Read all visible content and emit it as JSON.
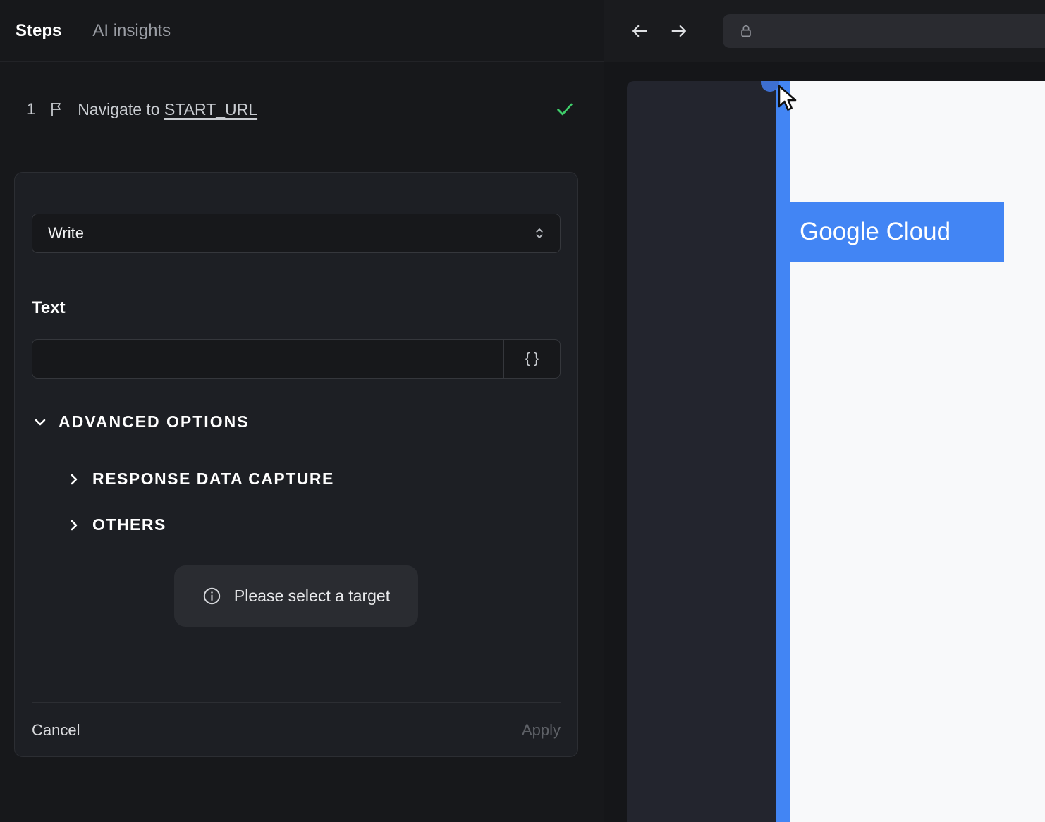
{
  "left_panel": {
    "tabs": [
      {
        "label": "Steps"
      },
      {
        "label": "AI insights"
      }
    ],
    "step": {
      "index": "1",
      "text": "Navigate to",
      "link": "START_URL"
    },
    "editor": {
      "action": {
        "value": "Write"
      },
      "text_field": {
        "label": "Text",
        "value": "",
        "placeholder": ""
      },
      "braces_button": "{ }",
      "advanced_toggle": "ADVANCED OPTIONS",
      "sections": [
        {
          "label": "RESPONSE DATA CAPTURE"
        },
        {
          "label": "OTHERS"
        }
      ],
      "notice": "Please select a target",
      "footer": {
        "cancel": "Cancel",
        "apply": "Apply"
      }
    }
  },
  "browser": {
    "address_bar": {
      "value": ""
    },
    "page": {
      "selected_element": "Google Cloud"
    }
  },
  "colors": {
    "accent_blue": "#4285f4",
    "success_green": "#3fcf6b",
    "panel_bg": "#17181b",
    "card_bg": "#1d1f24"
  }
}
